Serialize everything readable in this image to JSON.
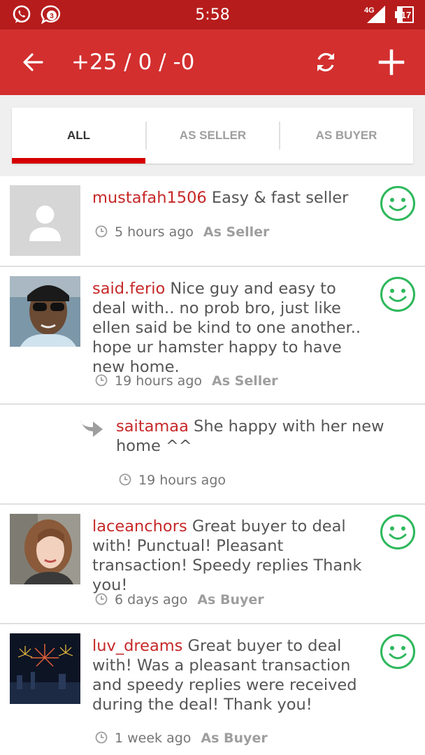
{
  "status_bar": {
    "time": "5:58",
    "notification_count": "3",
    "network": "4G",
    "battery": "17",
    "icons": [
      "whatsapp-icon",
      "chat-bubble-icon",
      "signal-icon",
      "battery-icon"
    ]
  },
  "app_bar": {
    "title": "+25 / 0 / -0",
    "icons": [
      "back-arrow-icon",
      "refresh-icon",
      "add-icon"
    ]
  },
  "tabs": [
    {
      "label": "ALL",
      "active": true
    },
    {
      "label": "AS SELLER",
      "active": false
    },
    {
      "label": "AS BUYER",
      "active": false
    }
  ],
  "reviews": [
    {
      "username": "mustafah1506",
      "text": "Easy & fast seller",
      "time": "5 hours ago",
      "role": "As Seller",
      "rating_icon": "smiley-icon"
    },
    {
      "username": "said.ferio",
      "text": "Nice guy and easy to deal with.. no prob bro, just like ellen said be kind to one another.. hope ur hamster happy to have new home.",
      "time": "19 hours ago",
      "role": "As Seller",
      "rating_icon": "smiley-icon",
      "reply": {
        "username": "saitamaa",
        "text": "She happy with her new home ^^",
        "time": "19 hours ago"
      }
    },
    {
      "username": "laceanchors",
      "text": "Great buyer to deal with! Punctual!  Pleasant transaction! Speedy replies Thank you!",
      "time": "6 days ago",
      "role": "As Buyer",
      "rating_icon": "smiley-icon"
    },
    {
      "username": "luv_dreams",
      "text": "Great buyer to deal with! Was a pleasant transaction and speedy replies were received during the deal!  Thank you!",
      "time": "1 week ago",
      "role": "As Buyer",
      "rating_icon": "smiley-icon"
    }
  ],
  "colors": {
    "status_bar": "#b71c1c",
    "app_bar": "#d32f2f",
    "username": "#c62828",
    "smiley": "#2eb85c",
    "tab_indicator": "#d50000"
  }
}
